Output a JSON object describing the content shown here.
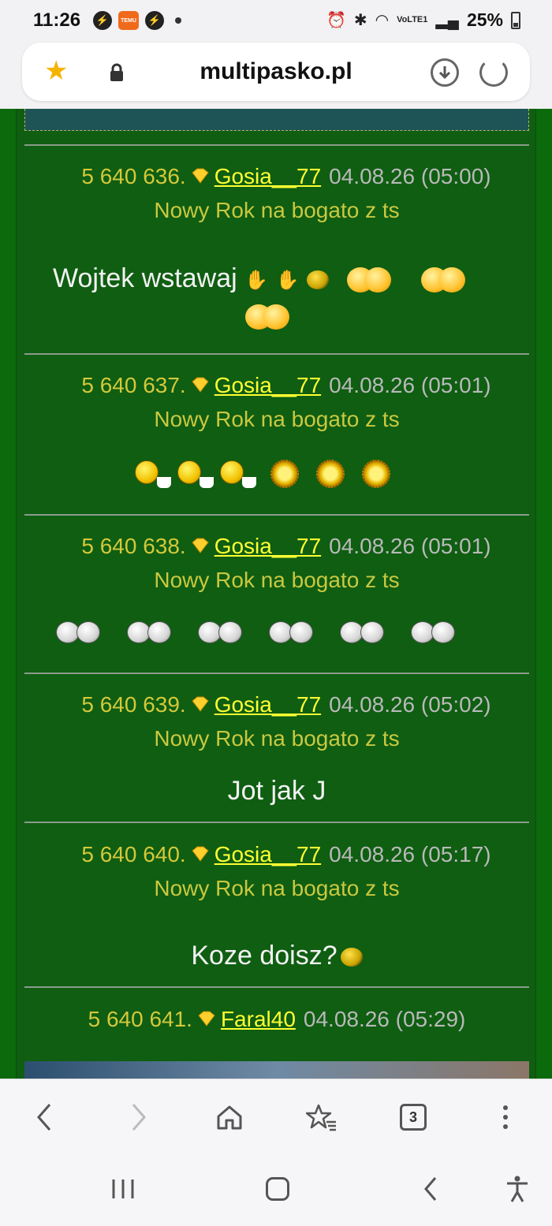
{
  "status_bar": {
    "time": "11:26",
    "temu_label": "TEMU",
    "network_label": "VoLTE1",
    "battery": "25%"
  },
  "url_bar": {
    "domain": "multipasko.pl"
  },
  "posts": [
    {
      "number": "5 640 636.",
      "user": "Gosia__77",
      "date": "04.08.26 (05:00)",
      "topic": "Nowy Rok na bogato z ts",
      "body": "Wojtek wstawaj"
    },
    {
      "number": "5 640 637.",
      "user": "Gosia__77",
      "date": "04.08.26 (05:01)",
      "topic": "Nowy Rok na bogato z ts",
      "body": ""
    },
    {
      "number": "5 640 638.",
      "user": "Gosia__77",
      "date": "04.08.26 (05:01)",
      "topic": "Nowy Rok na bogato z ts",
      "body": ""
    },
    {
      "number": "5 640 639.",
      "user": "Gosia__77",
      "date": "04.08.26 (05:02)",
      "topic": "Nowy Rok na bogato z ts",
      "body": "Jot jak J"
    },
    {
      "number": "5 640 640.",
      "user": "Gosia__77",
      "date": "04.08.26 (05:17)",
      "topic": "Nowy Rok na bogato z ts",
      "body": "Koze doisz?"
    },
    {
      "number": "5 640 641.",
      "user": "Faral40",
      "date": "04.08.26 (05:29)",
      "topic": "",
      "body": ""
    }
  ],
  "toolbar": {
    "tab_count": "3"
  },
  "colors": {
    "page_bg": "#0b6a0b",
    "username": "#ffff33",
    "meta": "#d4c83a",
    "date": "#b9b9b9"
  },
  "icons": [
    "star-icon",
    "lock-icon",
    "download-icon",
    "reload-icon",
    "gem-icon",
    "back-icon",
    "forward-icon",
    "home-icon",
    "bookmarks-icon",
    "tabs-icon",
    "menu-icon",
    "recent-apps-icon",
    "accessibility-icon"
  ]
}
